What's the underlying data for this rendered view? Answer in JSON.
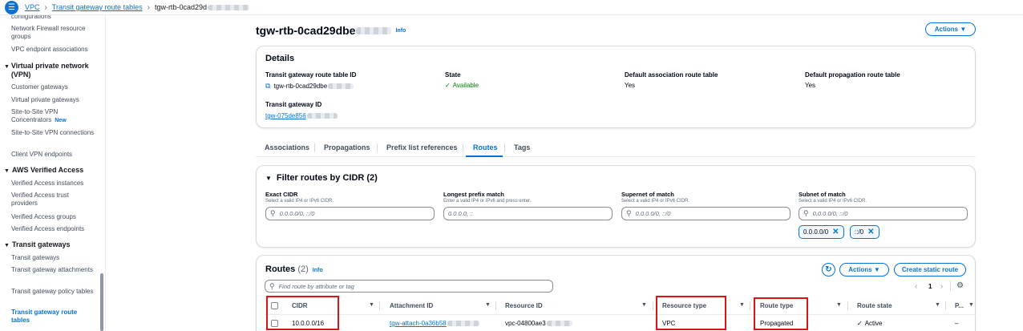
{
  "breadcrumb": [
    "VPC",
    "Transit gateway route tables",
    "tgw-rtb-0cad29d"
  ],
  "sidebar": {
    "items_top": [
      "configurations",
      "Network Firewall resource groups",
      "VPC endpoint associations"
    ],
    "vpn_header": "Virtual private network (VPN)",
    "vpn_items": [
      "Customer gateways",
      "Virtual private gateways",
      "Site-to-Site VPN Concentrators",
      "Site-to-Site VPN connections",
      "Client VPN endpoints"
    ],
    "new_badge": "New",
    "ava_header": "AWS Verified Access",
    "ava_items": [
      "Verified Access instances",
      "Verified Access trust providers",
      "Verified Access groups",
      "Verified Access endpoints"
    ],
    "tg_header": "Transit gateways",
    "tg_items": [
      "Transit gateways",
      "Transit gateway attachments",
      "Transit gateway policy tables",
      "Transit gateway route tables"
    ]
  },
  "page": {
    "title": "tgw-rtb-0cad29dbe",
    "info": "Info",
    "actions": "Actions"
  },
  "details": {
    "title": "Details",
    "fields": [
      {
        "label": "Transit gateway route table ID",
        "value": "tgw-rtb-0cad29dbe"
      },
      {
        "label": "State",
        "value": "Available"
      },
      {
        "label": "Default association route table",
        "value": "Yes"
      },
      {
        "label": "Default propagation route table",
        "value": "Yes"
      },
      {
        "label": "Transit gateway ID",
        "value": "tgw-075de856"
      }
    ]
  },
  "tabs": [
    "Associations",
    "Propagations",
    "Prefix list references",
    "Routes",
    "Tags"
  ],
  "active_tab": "Routes",
  "filter": {
    "title": "Filter routes by CIDR (2)",
    "fields": [
      {
        "label": "Exact CIDR",
        "desc": "Select a valid IP4 or IPv6 CIDR.",
        "placeholder": "0.0.0.0/0, ::/0"
      },
      {
        "label": "Longest prefix match",
        "desc": "Enter a valid IP4 or IPv6 and press enter.",
        "placeholder": "0.0.0.0, ::"
      },
      {
        "label": "Supernet of match",
        "desc": "Select a valid IP4 or IPv6 CIDR.",
        "placeholder": "0.0.0.0/0, ::/0"
      },
      {
        "label": "Subnet of match",
        "desc": "Select a valid IP4 or IPv6 CIDR.",
        "placeholder": "0.0.0.0/0, ::/0"
      }
    ],
    "chips": [
      "0.0.0.0/0",
      "::/0"
    ]
  },
  "routes": {
    "title": "Routes",
    "count": "(2)",
    "info": "Info",
    "actions": "Actions",
    "create": "Create static route",
    "search_placeholder": "Find route by attribute or tag",
    "page": "1",
    "columns": [
      "CIDR",
      "Attachment ID",
      "Resource ID",
      "Resource type",
      "Route type",
      "Route state",
      "P..."
    ],
    "row": {
      "cidr": "10.0.0.0/16",
      "attachment": "tgw-attach-0a36b58",
      "resource_id": "vpc-04800ae3",
      "resource_type": "VPC",
      "route_type": "Propagated",
      "state": "Active",
      "p": "–"
    }
  },
  "colors": {
    "accent": "#0972d3",
    "success": "#037f0c",
    "highlight": "#d91515"
  }
}
